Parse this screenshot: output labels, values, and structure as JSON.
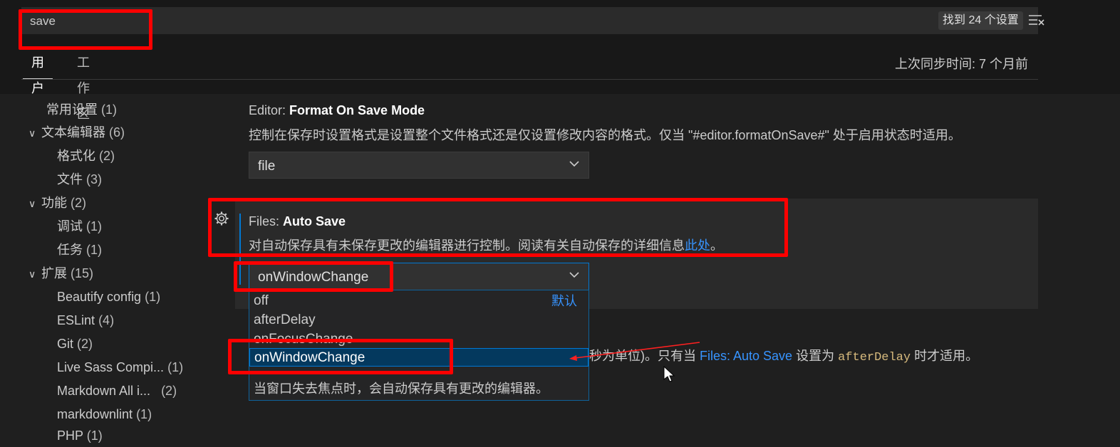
{
  "search": {
    "value": "save",
    "result_count": "找到 24 个设置"
  },
  "tabs": [
    {
      "label": "用户"
    },
    {
      "label": "工作区"
    }
  ],
  "sync_time": "上次同步时间: 7 个月前",
  "toc": {
    "common": {
      "label": "常用设置",
      "count": "(1)"
    },
    "text_editor": {
      "label": "文本编辑器",
      "count": "(6)"
    },
    "formatting": {
      "label": "格式化",
      "count": "(2)"
    },
    "files": {
      "label": "文件",
      "count": "(3)"
    },
    "features": {
      "label": "功能",
      "count": "(2)"
    },
    "debug": {
      "label": "调试",
      "count": "(1)"
    },
    "tasks": {
      "label": "任务",
      "count": "(1)"
    },
    "extensions": {
      "label": "扩展",
      "count": "(15)"
    },
    "beautify": {
      "label": "Beautify config",
      "count": "(1)"
    },
    "eslint": {
      "label": "ESLint",
      "count": "(4)"
    },
    "git": {
      "label": "Git",
      "count": "(2)"
    },
    "live_sass": {
      "label": "Live Sass Compi...",
      "count": "(1)"
    },
    "markdown_all": {
      "label": "Markdown All i...",
      "count": "(2)"
    },
    "markdownlint": {
      "label": "markdownlint",
      "count": "(1)"
    },
    "php": {
      "label": "PHP",
      "count": "(1)"
    }
  },
  "format_on_save_mode": {
    "category": "Editor: ",
    "name": "Format On Save Mode",
    "description": "控制在保存时设置格式是设置整个文件格式还是仅设置修改内容的格式。仅当 \"#editor.formatOnSave#\" 处于启用状态时适用。",
    "value": "file"
  },
  "auto_save": {
    "category": "Files: ",
    "name": "Auto Save",
    "description": "对自动保存具有未保存更改的编辑器进行控制。阅读有关自动保存的详细信息",
    "link": "此处",
    "desc_end": "。",
    "value": "onWindowChange",
    "options": [
      {
        "label": "off",
        "tag": "默认"
      },
      {
        "label": "afterDelay"
      },
      {
        "label": "onFocusChange"
      },
      {
        "label": "onWindowChange"
      }
    ],
    "option_description": "当窗口失去焦点时，会自动保存具有更改的编辑器。"
  },
  "auto_save_delay": {
    "desc_pre": "秒为单位)。只有当 ",
    "link": "Files: Auto Save",
    "desc_mid": " 设置为 ",
    "code": "afterDelay",
    "desc_post": " 时才适用。"
  },
  "colors": {
    "accent": "#0078d4",
    "link": "#3794ff",
    "highlight": "#ff0000"
  }
}
